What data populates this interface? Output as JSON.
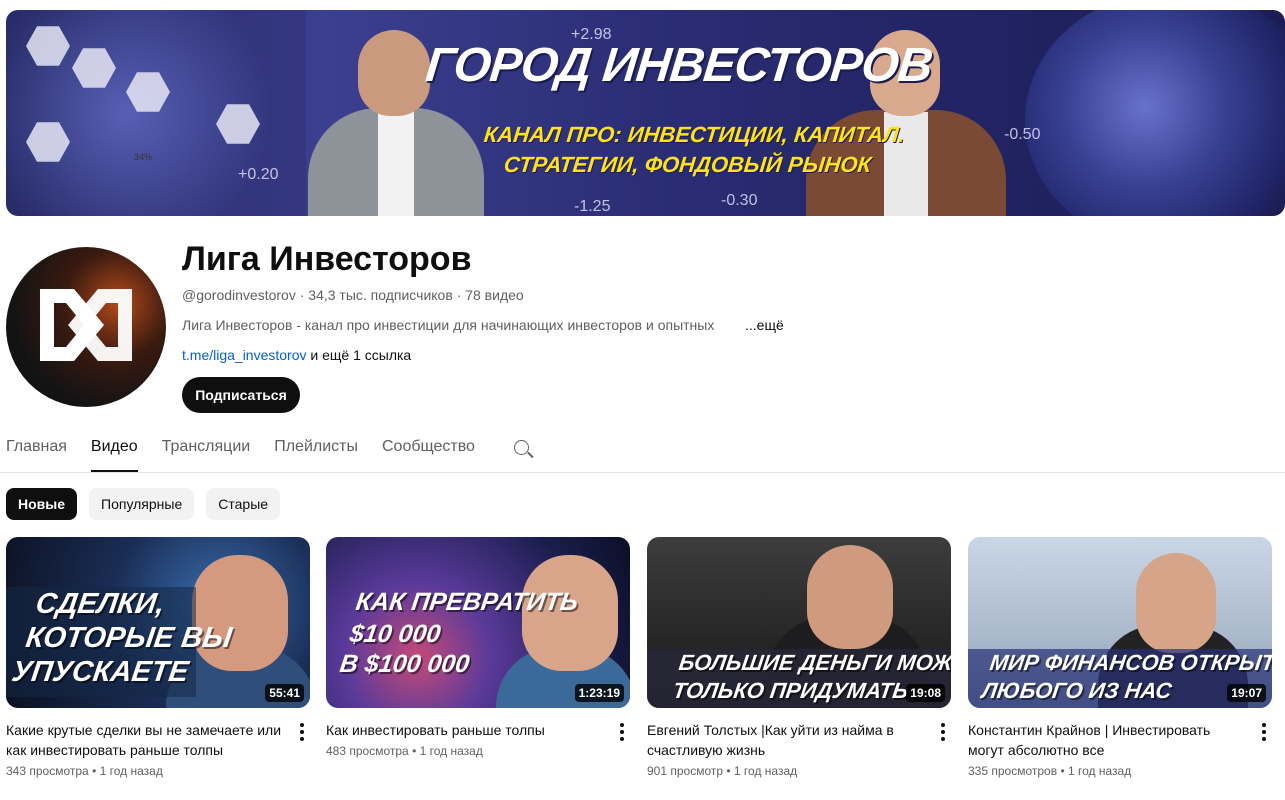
{
  "banner": {
    "title": "ГОРОД ИНВЕСТОРОВ",
    "subtitle_line1": "КАНАЛ ПРО: ИНВЕСТИЦИИ, КАПИТАЛ.",
    "subtitle_line2": "СТРАТЕГИИ, ФОНДОВЫЙ РЫНОК",
    "numbers": [
      "+2.98",
      "+0.20",
      "-1.25",
      "-0.30",
      "-0.50",
      "34%"
    ]
  },
  "channel": {
    "name": "Лига Инвесторов",
    "handle": "@gorodinvestorov",
    "subscribers": "34,3 тыс. подписчиков",
    "videos_count": "78 видео",
    "description": "Лига Инвесторов - канал про инвестиции для начинающих инвесторов и опытных",
    "more": "...ещё",
    "link": "t.me/liga_investorov",
    "more_links": "и ещё 1 ссылка",
    "subscribe_label": "Подписаться"
  },
  "tabs": [
    "Главная",
    "Видео",
    "Трансляции",
    "Плейлисты",
    "Сообщество"
  ],
  "active_tab": "Видео",
  "chips": [
    "Новые",
    "Популярные",
    "Старые"
  ],
  "videos": [
    {
      "thumb_lines": [
        "СДЕЛКИ,",
        "КОТОРЫЕ ВЫ",
        "УПУСКАЕТЕ"
      ],
      "duration": "55:41",
      "title": "Какие крутые сделки вы не замечаете или как инвестировать раньше толпы",
      "views": "343 просмотра",
      "age": "1 год назад"
    },
    {
      "thumb_lines": [
        "КАК ПРЕВРАТИТЬ",
        "$10 000",
        "В $100 000"
      ],
      "duration": "1:23:19",
      "title": "Как инвестировать раньше толпы",
      "views": "483 просмотра",
      "age": "1 год назад"
    },
    {
      "thumb_lines": [
        "БОЛЬШИЕ ДЕНЬГИ МОЖНО",
        "ТОЛЬКО ПРИДУМАТЬ"
      ],
      "duration": "19:08",
      "title": "Евгений Толстых |Как уйти из найма в счастливую жизнь",
      "views": "901 просмотр",
      "age": "1 год назад"
    },
    {
      "thumb_lines": [
        "МИР ФИНАНСОВ ОТКРЫТ ДЛЯ",
        "ЛЮБОГО ИЗ НАС"
      ],
      "duration": "19:07",
      "title": "Константин Крайнов | Инвестировать могут абсолютно все",
      "views": "335 просмотров",
      "age": "1 год назад"
    }
  ],
  "colors": {
    "link": "#065fd4",
    "text_primary": "#0f0f0f",
    "text_secondary": "#606060",
    "chip_bg": "#f2f2f2",
    "banner_yellow": "#ffe21a"
  }
}
